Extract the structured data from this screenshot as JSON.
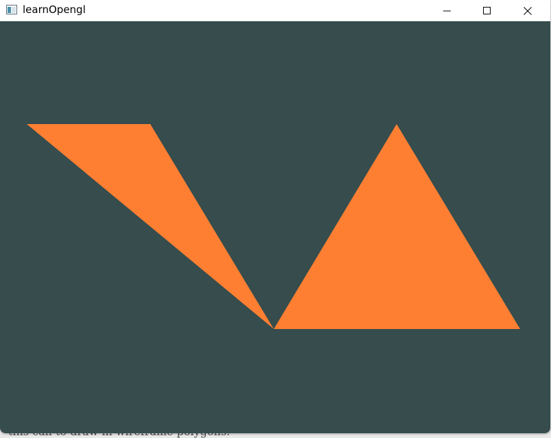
{
  "window": {
    "title": "learnOpengl"
  },
  "background_text": "this call to draw in wireframe polygons.",
  "colors": {
    "clear_color": "#364c4d",
    "triangle_fill": "#fe7f32",
    "titlebar": "#ffffff"
  },
  "icons": {
    "app": "app-window-icon",
    "minimize": "minimize-icon",
    "maximize": "maximize-icon",
    "close": "close-icon"
  }
}
